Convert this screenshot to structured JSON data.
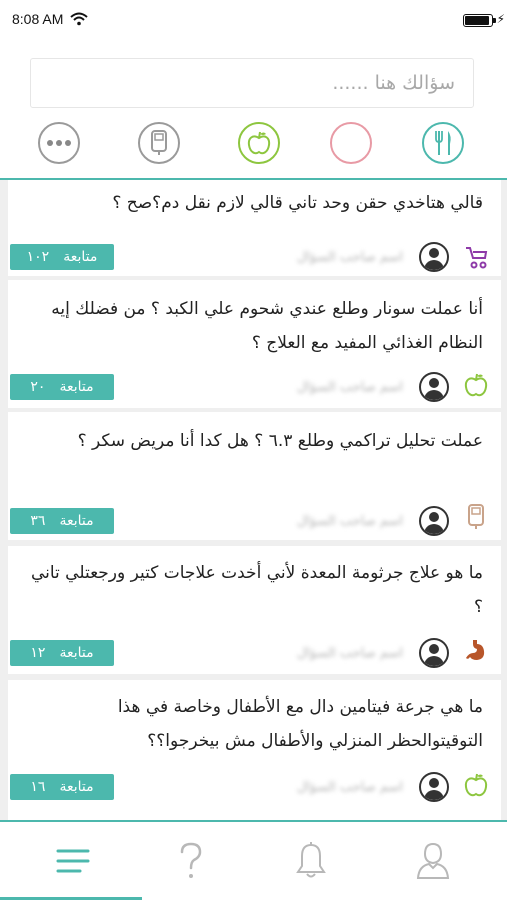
{
  "status_bar": {
    "time": "8:08 AM"
  },
  "search": {
    "placeholder": "سؤالك هنا ......"
  },
  "categories": [
    {
      "name": "more",
      "icon": "more-dots-icon",
      "color": "#9a9a9a"
    },
    {
      "name": "diabetes",
      "icon": "glucose-meter-icon",
      "color": "#9a9a9a"
    },
    {
      "name": "nutrition",
      "icon": "apple-icon",
      "color": "#8dc63f"
    },
    {
      "name": "blank",
      "icon": "circle-icon",
      "color": "#e89aa5"
    },
    {
      "name": "food",
      "icon": "fork-knife-icon",
      "color": "#4cb8ad"
    }
  ],
  "questions": [
    {
      "text": "قالي هتاخدي حقن وحد تاني قالي لازم نقل دم؟صح ؟",
      "followers": "١٠٢",
      "follow_label": "متابعة",
      "asker": "اسم صاحب السؤال",
      "category_icon": "stroller-icon",
      "category_color": "#8e3aa8"
    },
    {
      "text": "أنا عملت سونار وطلع عندي شحوم علي الكبد ؟ من فضلك إيه النظام الغذائي المفيد  مع العلاج ؟",
      "followers": "٢٠",
      "follow_label": "متابعة",
      "asker": "اسم صاحب السؤال",
      "category_icon": "apple-icon",
      "category_color": "#8dc63f"
    },
    {
      "text": "عملت تحليل تراكمي وطلع ٦.٣ ؟ هل كدا أنا مريض سكر ؟",
      "followers": "٣٦",
      "follow_label": "متابعة",
      "asker": "اسم صاحب السؤال",
      "category_icon": "glucose-meter-icon",
      "category_color": "#c9a38a"
    },
    {
      "text": "ما هو علاج جرثومة المعدة لأني أخدت علاجات كتير ورجعتلي تاني ؟",
      "followers": "١٢",
      "follow_label": "متابعة",
      "asker": "اسم صاحب السؤال",
      "category_icon": "stomach-icon",
      "category_color": "#b8562a"
    },
    {
      "text": "ما هي جرعة فيتامين دال مع الأطفال وخاصة في هذا التوقيتوالحظر المنزلي والأطفال مش بيخرجوا؟؟",
      "followers": "١٦",
      "follow_label": "متابعة",
      "asker": "اسم صاحب السؤال",
      "category_icon": "apple-icon",
      "category_color": "#8dc63f"
    }
  ],
  "tabbar": [
    {
      "name": "feed",
      "icon": "menu-lines-icon",
      "active": true
    },
    {
      "name": "ask",
      "icon": "question-mark-icon",
      "active": false
    },
    {
      "name": "notifications",
      "icon": "bell-icon",
      "active": false
    },
    {
      "name": "profile",
      "icon": "user-icon",
      "active": false
    }
  ],
  "colors": {
    "accent": "#4cb8ad",
    "background": "#efefef"
  }
}
